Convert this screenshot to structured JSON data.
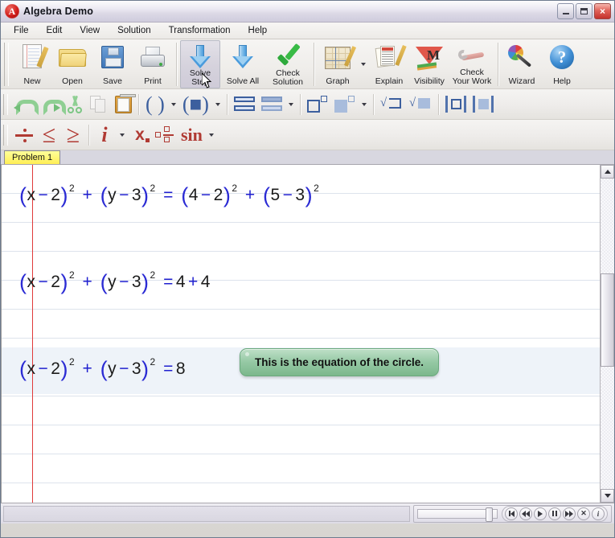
{
  "window": {
    "title": "Algebra Demo",
    "icon": "app-logo-icon",
    "minimize": "minimize-button",
    "maximize": "maximize-button",
    "close": "×"
  },
  "menu": {
    "items": [
      {
        "label": "File"
      },
      {
        "label": "Edit"
      },
      {
        "label": "View"
      },
      {
        "label": "Solution"
      },
      {
        "label": "Transformation"
      },
      {
        "label": "Help"
      }
    ]
  },
  "toolbar_main": {
    "buttons": [
      {
        "label": "New",
        "icon": "new-document-icon"
      },
      {
        "label": "Open",
        "icon": "open-folder-icon"
      },
      {
        "label": "Save",
        "icon": "floppy-disk-icon"
      },
      {
        "label": "Print",
        "icon": "printer-icon"
      },
      {
        "label_line1": "Solve",
        "label_line2": "Step",
        "icon": "down-arrow-icon",
        "state": "hover"
      },
      {
        "label": "Solve All",
        "icon": "down-arrow-icon"
      },
      {
        "label_line1": "Check",
        "label_line2": "Solution",
        "icon": "green-check-icon"
      },
      {
        "label": "Graph",
        "icon": "graph-plot-icon",
        "has_dropdown": true
      },
      {
        "label": "Explain",
        "icon": "explain-pages-icon"
      },
      {
        "label": "Visibility",
        "icon": "visibility-m-icon"
      },
      {
        "label_line1": "Check",
        "label_line2": "Your Work",
        "icon": "wrench-icon"
      },
      {
        "label": "Wizard",
        "icon": "magic-wand-icon"
      },
      {
        "label": "Help",
        "icon": "help-question-icon"
      }
    ]
  },
  "toolbar_edit": {
    "buttons": [
      {
        "icon": "undo-icon"
      },
      {
        "icon": "redo-icon"
      },
      {
        "icon": "scissors-cut-icon"
      },
      {
        "icon": "copy-icon",
        "disabled": true
      },
      {
        "icon": "paste-clipboard-icon"
      },
      {
        "icon": "parentheses-icon",
        "label": "( )",
        "has_dropdown": true
      },
      {
        "icon": "parentheses-filled-icon",
        "label": "(■)",
        "has_dropdown": true
      },
      {
        "icon": "stacked-equals-icon"
      },
      {
        "icon": "stacked-equals-pale-icon",
        "has_dropdown": true
      },
      {
        "icon": "square-exponent-icon"
      },
      {
        "icon": "square-exponent-filled-icon",
        "has_dropdown": true
      },
      {
        "icon": "radical-box-icon"
      },
      {
        "icon": "radical-box-filled-icon"
      },
      {
        "icon": "absolute-value-icon"
      },
      {
        "icon": "absolute-value-filled-icon"
      }
    ]
  },
  "toolbar_ops": {
    "buttons": [
      {
        "icon": "divide-icon",
        "label": "÷"
      },
      {
        "icon": "less-or-equal-icon",
        "label": "≤"
      },
      {
        "icon": "greater-or-equal-icon",
        "label": "≥"
      },
      {
        "icon": "imaginary-unit-icon",
        "label": "i",
        "has_dropdown": true
      },
      {
        "icon": "subscript-x-icon",
        "label": "x"
      },
      {
        "icon": "fraction-icon"
      },
      {
        "icon": "sine-function-icon",
        "label": "sin",
        "has_dropdown": true
      }
    ]
  },
  "tabs": {
    "items": [
      {
        "label": "Problem 1",
        "active": true
      }
    ]
  },
  "worksheet": {
    "lines": [
      {
        "id": "equation-line-1",
        "parts": [
          {
            "t": "(",
            "k": "par"
          },
          {
            "t": "x",
            "k": "var"
          },
          {
            "t": "−",
            "k": "op"
          },
          {
            "t": "2",
            "k": "var"
          },
          {
            "t": ")",
            "k": "par"
          },
          {
            "t": "2",
            "k": "sup"
          },
          {
            "t": "+",
            "k": "op"
          },
          {
            "t": "(",
            "k": "par"
          },
          {
            "t": "y",
            "k": "var"
          },
          {
            "t": "−",
            "k": "op"
          },
          {
            "t": "3",
            "k": "var"
          },
          {
            "t": ")",
            "k": "par"
          },
          {
            "t": "2",
            "k": "sup"
          },
          {
            "t": "=",
            "k": "op"
          },
          {
            "t": "(",
            "k": "par"
          },
          {
            "t": "4",
            "k": "var"
          },
          {
            "t": "−",
            "k": "op"
          },
          {
            "t": "2",
            "k": "var"
          },
          {
            "t": ")",
            "k": "par"
          },
          {
            "t": "2",
            "k": "sup"
          },
          {
            "t": "+",
            "k": "op"
          },
          {
            "t": "(",
            "k": "par"
          },
          {
            "t": "5",
            "k": "var"
          },
          {
            "t": "−",
            "k": "op"
          },
          {
            "t": "3",
            "k": "var"
          },
          {
            "t": ")",
            "k": "par"
          },
          {
            "t": "2",
            "k": "sup"
          }
        ],
        "plain": "(x - 2)^2 + (y - 3)^2 = (4 - 2)^2 + (5 - 3)^2"
      },
      {
        "id": "equation-line-2",
        "parts": [
          {
            "t": "(",
            "k": "par"
          },
          {
            "t": "x",
            "k": "var"
          },
          {
            "t": "−",
            "k": "op"
          },
          {
            "t": "2",
            "k": "var"
          },
          {
            "t": ")",
            "k": "par"
          },
          {
            "t": "2",
            "k": "sup"
          },
          {
            "t": "+",
            "k": "op"
          },
          {
            "t": "(",
            "k": "par"
          },
          {
            "t": "y",
            "k": "var"
          },
          {
            "t": "−",
            "k": "op"
          },
          {
            "t": "3",
            "k": "var"
          },
          {
            "t": ")",
            "k": "par"
          },
          {
            "t": "2",
            "k": "sup"
          },
          {
            "t": "=",
            "k": "op"
          },
          {
            "t": "4",
            "k": "var"
          },
          {
            "t": "+",
            "k": "op"
          },
          {
            "t": "4",
            "k": "var"
          }
        ],
        "plain": "(x - 2)^2 + (y - 3)^2 = 4 + 4"
      },
      {
        "id": "equation-line-3",
        "parts": [
          {
            "t": "(",
            "k": "par"
          },
          {
            "t": "x",
            "k": "var"
          },
          {
            "t": "−",
            "k": "op"
          },
          {
            "t": "2",
            "k": "var"
          },
          {
            "t": ")",
            "k": "par"
          },
          {
            "t": "2",
            "k": "sup"
          },
          {
            "t": "+",
            "k": "op"
          },
          {
            "t": "(",
            "k": "par"
          },
          {
            "t": "y",
            "k": "var"
          },
          {
            "t": "−",
            "k": "op"
          },
          {
            "t": "3",
            "k": "var"
          },
          {
            "t": ")",
            "k": "par"
          },
          {
            "t": "2",
            "k": "sup"
          },
          {
            "t": "=",
            "k": "op"
          },
          {
            "t": "8",
            "k": "var"
          }
        ],
        "plain": "(x - 2)^2 + (y - 3)^2 = 8"
      }
    ],
    "callout": "This is the equation of the circle.",
    "colors": {
      "math_blue": "#1f1fcf",
      "margin_red": "#e03a3a",
      "highlight": "#eef3f9",
      "callout_green": "#96c9a5"
    }
  },
  "scrollbar": {
    "up": "scroll-up-arrow",
    "down": "scroll-down-arrow"
  },
  "player": {
    "buttons": [
      {
        "icon": "skip-to-start-icon"
      },
      {
        "icon": "rewind-icon"
      },
      {
        "icon": "play-icon"
      },
      {
        "icon": "pause-icon"
      },
      {
        "icon": "fast-forward-icon"
      },
      {
        "icon": "stop-close-icon",
        "label": "✕"
      },
      {
        "icon": "info-icon",
        "label": "i"
      }
    ]
  }
}
